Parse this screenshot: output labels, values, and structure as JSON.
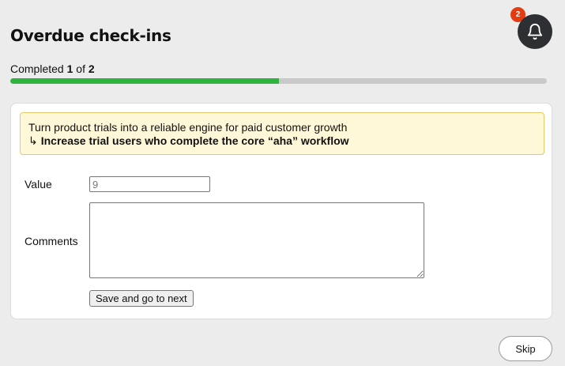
{
  "header": {
    "title": "Overdue check-ins",
    "notifications": {
      "count": "2",
      "icon": "bell-icon",
      "badge_color": "#e23d12"
    }
  },
  "progress": {
    "label_prefix": "Completed",
    "completed": "1",
    "separator": "of",
    "total": "2",
    "fraction": 0.5,
    "fill_color": "#2fb33f"
  },
  "checkin": {
    "objective": "Turn product trials into a reliable engine for paid customer growth",
    "key_result_arrow": "↳",
    "key_result": "Increase trial users who complete the core “aha” workflow",
    "value_label": "Value",
    "value_placeholder": "9",
    "value": "",
    "comments_label": "Comments",
    "comments": "",
    "save_label": "Save and go to next"
  },
  "footer": {
    "skip_label": "Skip"
  }
}
